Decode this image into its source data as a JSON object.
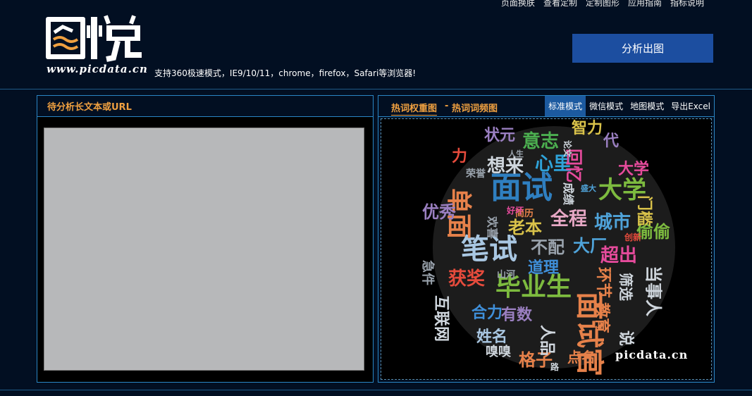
{
  "nav": {
    "items": [
      "页面换肤",
      "查看定制",
      "定制图形",
      "应用指南",
      "指标说明"
    ]
  },
  "brand": {
    "logo_text": "图悦",
    "url_text": "www.picdata.cn"
  },
  "support_text": "支持360极速模式，IE9/10/11，chrome，firefox，Safari等浏览器!",
  "analyze_button": "分析出图",
  "left_panel": {
    "title": "待分析长文本或URL",
    "textarea_value": ""
  },
  "right_panel": {
    "title_weight": "热词权重图",
    "title_sep": "-",
    "title_freq": "热词词频图",
    "modes": [
      "标准模式",
      "微信模式",
      "地图模式",
      "导出Excel"
    ],
    "active_mode": "标准模式",
    "watermark": "picdata.cn"
  },
  "wordcloud": {
    "words": [
      {
        "text": "面试",
        "color": "#2f7fc0"
      },
      {
        "text": "笔试",
        "color": "#a9c7e2"
      },
      {
        "text": "单面",
        "color": "#e6814a"
      },
      {
        "text": "毕业生",
        "color": "#7dbb3f"
      },
      {
        "text": "面试官",
        "color": "#e6814a"
      },
      {
        "text": "大学",
        "color": "#7dbb3f"
      },
      {
        "text": "获奖",
        "color": "#e64b3c"
      },
      {
        "text": "意志",
        "color": "#4caf50"
      },
      {
        "text": "想来",
        "color": "#cfd6dd"
      },
      {
        "text": "心里",
        "color": "#2fa3d9"
      },
      {
        "text": "全程",
        "color": "#e6a7c4"
      },
      {
        "text": "城市",
        "color": "#4fa3d9"
      },
      {
        "text": "老本",
        "color": "#d9c24a"
      },
      {
        "text": "不配",
        "color": "#9aa3ad"
      },
      {
        "text": "大厂",
        "color": "#4fa3d9"
      },
      {
        "text": "超出",
        "color": "#e64b9c"
      },
      {
        "text": "道理",
        "color": "#3f8fd9"
      },
      {
        "text": "合力",
        "color": "#3f8fd9"
      },
      {
        "text": "有数",
        "color": "#9a7fc0"
      },
      {
        "text": "姓名",
        "color": "#a9c7e2"
      },
      {
        "text": "格子",
        "color": "#e6814a"
      },
      {
        "text": "人品",
        "color": "#cfd6dd"
      },
      {
        "text": "教育",
        "color": "#e6814a"
      },
      {
        "text": "环节",
        "color": "#e6814a"
      },
      {
        "text": "筛选",
        "color": "#cfd6dd"
      },
      {
        "text": "偷偷",
        "color": "#7dbb3f"
      },
      {
        "text": "当事人",
        "color": "#cfd6dd"
      },
      {
        "text": "大学",
        "color": "#e64b9c"
      },
      {
        "text": "门槛",
        "color": "#d9c24a"
      },
      {
        "text": "回忆",
        "color": "#e64b9c"
      },
      {
        "text": "代",
        "color": "#9a7fc0"
      },
      {
        "text": "智力",
        "color": "#d9c24a"
      },
      {
        "text": "成绩",
        "color": "#cfd6dd"
      },
      {
        "text": "优秀",
        "color": "#9a7fc0"
      },
      {
        "text": "互联网",
        "color": "#cfd6dd"
      },
      {
        "text": "急件",
        "color": "#9aa3ad"
      },
      {
        "text": "嗅嗅",
        "color": "#cfd6dd"
      },
      {
        "text": "说",
        "color": "#cfd6dd"
      },
      {
        "text": "欢喜",
        "color": "#9aa3ad"
      },
      {
        "text": "山河",
        "color": "#9aa3ad"
      },
      {
        "text": "简历",
        "color": "#e6814a"
      },
      {
        "text": "好坏",
        "color": "#e64b9c"
      },
      {
        "text": "创新",
        "color": "#e64b3c"
      },
      {
        "text": "人生",
        "color": "#9aa3ad"
      },
      {
        "text": "荣誉",
        "color": "#9aa3ad"
      },
      {
        "text": "状元",
        "color": "#9a7fc0"
      },
      {
        "text": "论文",
        "color": "#cfd6dd"
      },
      {
        "text": "盛大",
        "color": "#4fa3d9"
      },
      {
        "text": "点名",
        "color": "#e6814a"
      },
      {
        "text": "路",
        "color": "#cfd6dd"
      },
      {
        "text": "力",
        "color": "#e64b3c"
      }
    ]
  }
}
